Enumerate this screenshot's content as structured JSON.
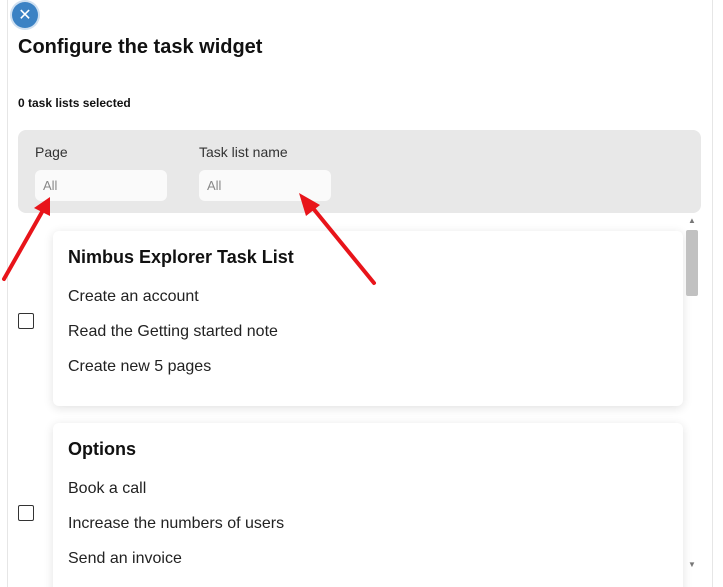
{
  "dialog": {
    "title": "Configure the task widget",
    "selected_count": "0 task lists selected",
    "close_icon": "close-icon",
    "close_glyph": "✕"
  },
  "filters": {
    "page": {
      "label": "Page",
      "placeholder": "All"
    },
    "task_list_name": {
      "label": "Task list name",
      "placeholder": "All"
    }
  },
  "task_lists": [
    {
      "title": "Nimbus Explorer Task List",
      "tasks": [
        "Create an account",
        "Read the Getting started note",
        "Create new 5 pages"
      ]
    },
    {
      "title": "Options",
      "tasks": [
        "Book a call",
        "Increase the numbers of users",
        "Send an invoice"
      ]
    }
  ],
  "colors": {
    "accent": "#3b82c4",
    "filter_bar": "#e8e8e8",
    "annotation_arrow": "#e8141a"
  }
}
